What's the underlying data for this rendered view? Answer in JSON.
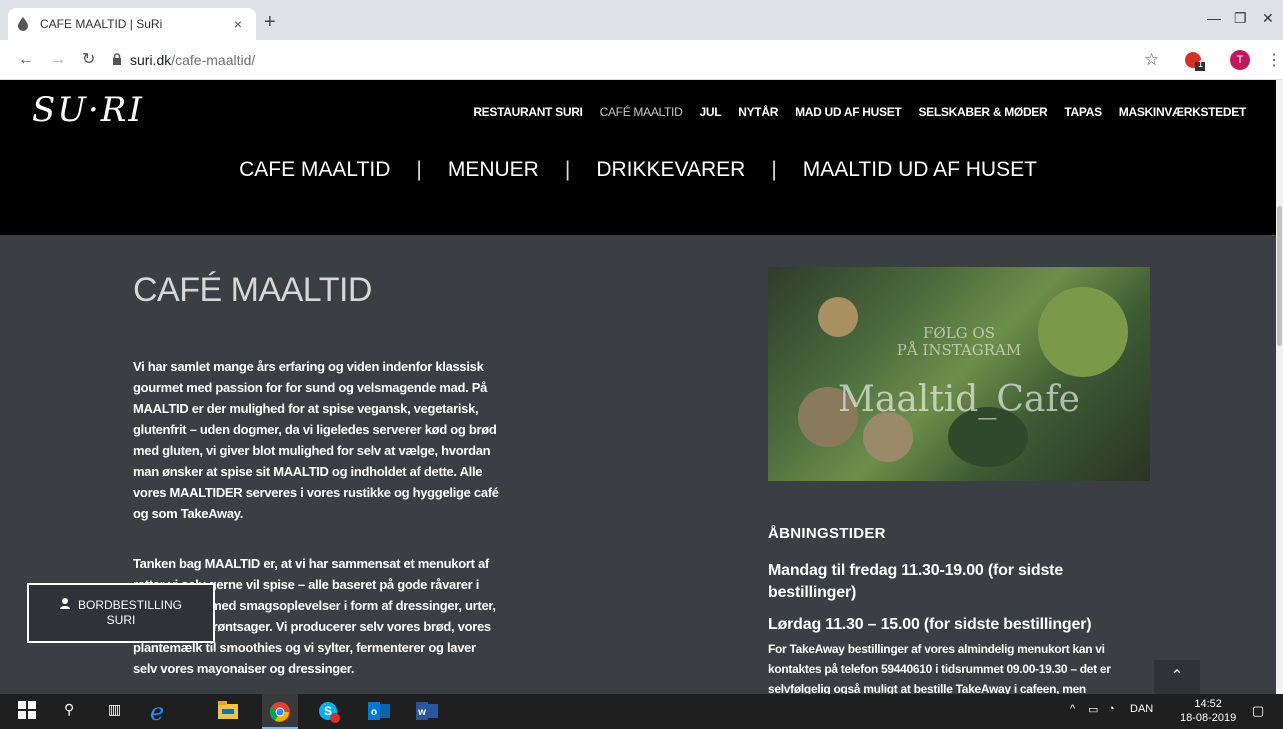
{
  "browser": {
    "tab_title": "CAFE MAALTID | SuRi",
    "url_domain": "suri.dk",
    "url_path": "/cafe-maaltid/",
    "profile_initial": "T",
    "extension_badge": "1"
  },
  "site": {
    "logo": "SU·RI",
    "main_nav": [
      {
        "label": "RESTAURANT SURI"
      },
      {
        "label": "CAFÉ MAALTID"
      },
      {
        "label": "JUL"
      },
      {
        "label": "NYTÅR"
      },
      {
        "label": "MAD UD AF HUSET"
      },
      {
        "label": "SELSKABER & MØDER"
      },
      {
        "label": "TAPAS"
      },
      {
        "label": "MASKINVÆRKSTEDET"
      }
    ],
    "sub_nav": [
      {
        "label": "CAFE MAALTID"
      },
      {
        "label": "MENUER"
      },
      {
        "label": "DRIKKEVARER"
      },
      {
        "label": "MAALTID UD AF HUSET"
      }
    ],
    "separator": "|"
  },
  "content": {
    "heading": "CAFÉ MAALTID",
    "paragraph1": "Vi har samlet mange års erfaring og viden indenfor klassisk gourmet med passion for for sund og velsmagende mad. På MAALTID er der mulighed for at spise vegansk, vegetarisk, glutenfrit – uden dogmer, da vi ligeledes serverer kød og brød med gluten, vi giver blot mulighed for selv at vælge, hvordan man ønsker at spise sit MAALTID og indholdet af dette. Alle vores MAALTIDER serveres i vores rustikke og hyggelige café og som TakeAway.",
    "paragraph2": "Tanken bag MAALTID er, at vi har sammensat et menukort af retter vi selv gerne vil spise – alle baseret på gode råvarer i kombination med smagsoplevelser i form af dressinger, urter, kød, fisk og grøntsager. Vi producerer selv vores brød, vores plantemælk til smoothies og vi sylter, fermenterer og laver selv vores mayonaiser og dressinger.",
    "instagram_line1": "FØLG OS",
    "instagram_line2": "PÅ INSTAGRAM",
    "instagram_brand": "Maaltid_Cafe",
    "hours_title": "ÅBNINGSTIDER",
    "hours_weekday": "Mandag til fredag 11.30-19.00 (for sidste bestillinger)",
    "hours_saturday": "Lørdag 11.30 – 15.00 (for sidste bestillinger)",
    "takeaway_text": "For TakeAway bestillinger af vores almindelig menukort kan vi kontaktes på telefon 59440610 i tidsrummet 09.00-19.30 – det er selvfølgelig også muligt at bestille TakeAway i cafeen, men"
  },
  "booking": {
    "line1": "BORDBESTILLING",
    "line2": "SURI"
  },
  "taskbar": {
    "language": "DAN",
    "time": "14:52",
    "date": "18-08-2019"
  }
}
